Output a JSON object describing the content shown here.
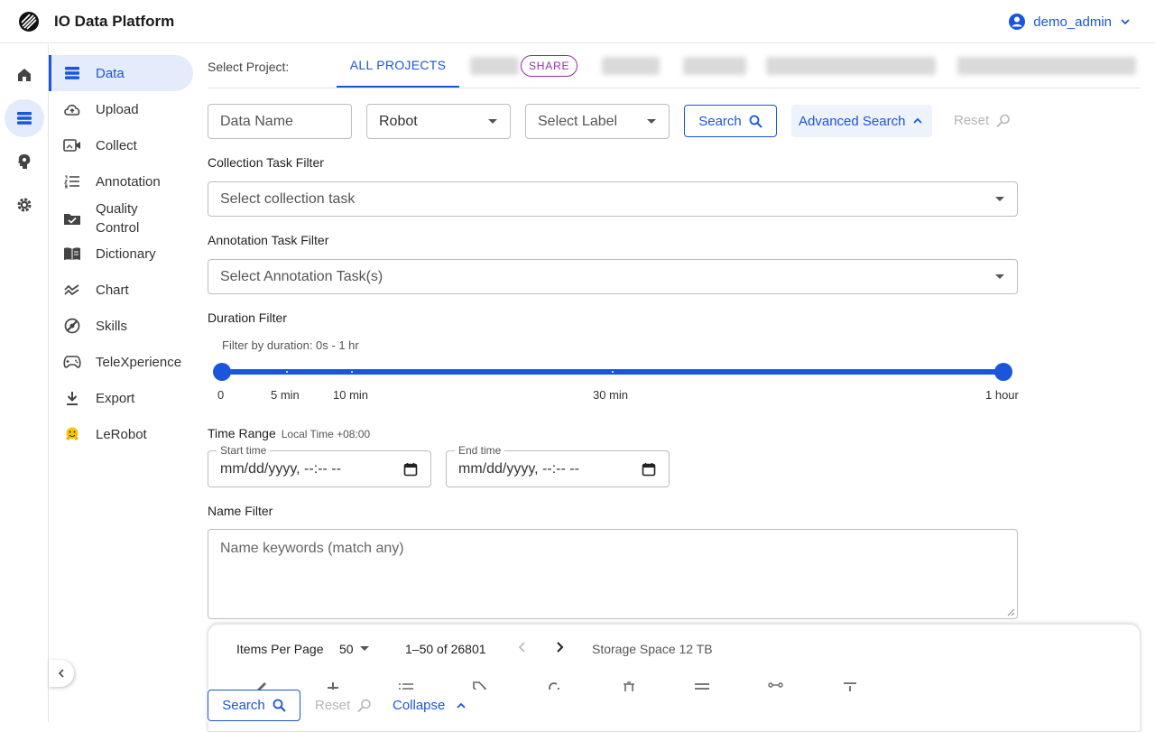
{
  "app": {
    "title": "IO Data Platform"
  },
  "user": {
    "name": "demo_admin"
  },
  "colors": {
    "accent": "#1a56db",
    "share": "#9c27b0"
  },
  "rail": [
    {
      "icon": "home-icon",
      "active": false
    },
    {
      "icon": "data-list-icon",
      "active": true
    },
    {
      "icon": "brain-icon",
      "active": false
    },
    {
      "icon": "gear-icon",
      "active": false
    }
  ],
  "sidebar": {
    "items": [
      {
        "label": "Data",
        "icon": "data-list-icon",
        "active": true
      },
      {
        "label": "Upload",
        "icon": "cloud-upload-icon"
      },
      {
        "label": "Collect",
        "icon": "video-icon"
      },
      {
        "label": "Annotation",
        "icon": "numbered-list-icon"
      },
      {
        "label": "Quality\nControl",
        "icon": "quality-check-icon"
      },
      {
        "label": "Dictionary",
        "icon": "book-icon"
      },
      {
        "label": "Chart",
        "icon": "chart-line-icon"
      },
      {
        "label": "Skills",
        "icon": "skills-icon"
      },
      {
        "label": "TeleXperience",
        "icon": "gamepad-icon"
      },
      {
        "label": "Export",
        "icon": "download-icon"
      },
      {
        "label": "LeRobot",
        "icon": "hugging-face-icon"
      }
    ]
  },
  "projects": {
    "label": "Select Project:",
    "all_tab": "ALL PROJECTS",
    "share_badge": "SHARE"
  },
  "filters": {
    "data_name_placeholder": "Data Name",
    "robot_value": "Robot",
    "label_placeholder": "Select Label",
    "search": "Search",
    "advanced_search": "Advanced Search",
    "reset": "Reset",
    "collection_label": "Collection Task Filter",
    "collection_placeholder": "Select collection task",
    "annotation_label": "Annotation Task Filter",
    "annotation_placeholder": "Select Annotation Task(s)",
    "duration_label": "Duration Filter",
    "duration_caption": "Filter by duration: 0s - 1 hr",
    "duration_range": {
      "min_seconds": 0,
      "max_seconds": 3600,
      "selected": [
        0,
        3600
      ]
    },
    "marks": [
      "0",
      "5 min",
      "10 min",
      "30 min",
      "1 hour"
    ],
    "time_range_label": "Time Range",
    "time_zone": "Local Time +08:00",
    "start_label": "Start time",
    "end_label": "End time",
    "datetime_placeholder": "mm/dd/yyyy, --:-- --",
    "name_filter_label": "Name Filter",
    "name_filter_placeholder": "Name keywords (match any)",
    "collapse": "Collapse"
  },
  "pagination": {
    "items_per_page_label": "Items Per Page",
    "items_per_page": "50",
    "range": "1–50 of 26801",
    "storage": "Storage Space 12 TB"
  }
}
